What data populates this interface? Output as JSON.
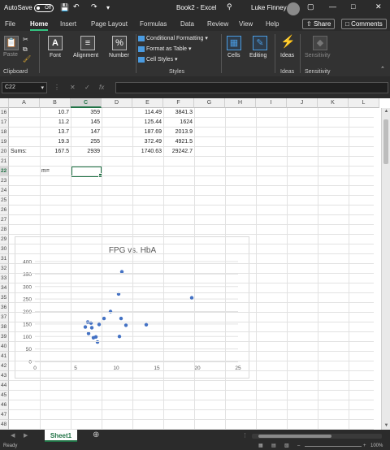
{
  "titlebar": {
    "autosave_label": "AutoSave",
    "autosave_state": "Off",
    "file_title": "Book2 - Excel",
    "user_name": "Luke Finney"
  },
  "tabs": [
    "File",
    "Home",
    "Insert",
    "Page Layout",
    "Formulas",
    "Data",
    "Review",
    "View",
    "Help"
  ],
  "active_tab": "Home",
  "share_label": "Share",
  "comments_label": "Comments",
  "ribbon": {
    "paste": "Paste",
    "clipboard": "Clipboard",
    "font": "Font",
    "alignment": "Alignment",
    "number": "Number",
    "conditional_formatting": "Conditional Formatting",
    "format_as_table": "Format as Table",
    "cell_styles": "Cell Styles",
    "styles": "Styles",
    "cells": "Cells",
    "editing": "Editing",
    "ideas": "Ideas",
    "ideas_group": "Ideas",
    "sensitivity": "Sensitivity",
    "sensitivity_group": "Sensitivity"
  },
  "formula_bar": {
    "name_box": "C22",
    "formula": ""
  },
  "columns": [
    "A",
    "B",
    "C",
    "D",
    "E",
    "F",
    "G",
    "H",
    "I",
    "J",
    "K",
    "L"
  ],
  "rows": [
    16,
    17,
    18,
    19,
    20,
    21,
    22,
    23,
    24,
    25,
    26,
    27,
    28,
    29,
    30,
    31,
    32,
    33,
    34,
    35,
    36,
    37,
    38,
    39,
    40,
    41,
    42,
    43,
    44,
    45,
    46,
    47,
    48
  ],
  "cells": {
    "B16": "10.7",
    "C16": "359",
    "E16": "114.49",
    "F16": "3841.3",
    "B17": "11.2",
    "C17": "145",
    "E17": "125.44",
    "F17": "1624",
    "B18": "13.7",
    "C18": "147",
    "E18": "187.69",
    "F18": "2013.9",
    "B19": "19.3",
    "C19": "255",
    "E19": "372.49",
    "F19": "4921.5",
    "A20": "Sums:",
    "B20": "167.5",
    "C20": "2939",
    "E20": "1740.63",
    "F20": "29242.7",
    "B22": "m="
  },
  "chart_data": {
    "type": "scatter",
    "title": "FPG vs. HbA",
    "xlim": [
      0,
      25
    ],
    "ylim": [
      0,
      400
    ],
    "x_ticks": [
      0,
      5,
      10,
      15,
      20,
      25
    ],
    "y_ticks": [
      0,
      50,
      100,
      150,
      200,
      250,
      300,
      350,
      400
    ],
    "points": [
      [
        6.2,
        138
      ],
      [
        6.5,
        158
      ],
      [
        6.6,
        112
      ],
      [
        6.9,
        154
      ],
      [
        7.0,
        135
      ],
      [
        7.2,
        95
      ],
      [
        7.5,
        98
      ],
      [
        7.7,
        78
      ],
      [
        7.9,
        148
      ],
      [
        8.5,
        172
      ],
      [
        9.3,
        200
      ],
      [
        10.3,
        270
      ],
      [
        10.4,
        100
      ],
      [
        10.6,
        172
      ],
      [
        10.7,
        359
      ],
      [
        11.2,
        145
      ],
      [
        13.7,
        147
      ],
      [
        19.3,
        255
      ]
    ],
    "marker_color": "#4472C4"
  },
  "sheets": [
    "Sheet1"
  ],
  "status": {
    "ready": "Ready",
    "zoom": "100%"
  }
}
